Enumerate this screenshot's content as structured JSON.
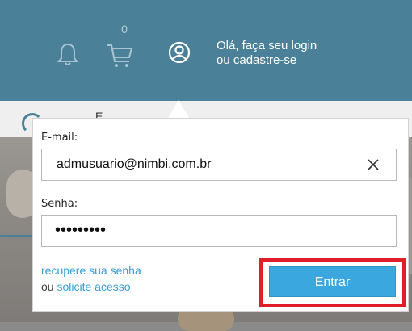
{
  "header": {
    "cart_count": "0",
    "greeting_line1": "Olá, faça seu login",
    "greeting_line2": "ou cadastre-se",
    "background_color": "#4b8198"
  },
  "background": {
    "partial_text": "E..."
  },
  "login": {
    "email_label": "E-mail:",
    "email_value": "admusuario@nimbi.com.br",
    "password_label": "Senha:",
    "password_value": "•••••••••",
    "recover_link": "recupere sua senha",
    "or_text": "ou",
    "request_link": "solicite acesso",
    "submit_label": "Entrar",
    "accent_color": "#3aa8de",
    "highlight_color": "#e01e2a"
  },
  "icons": {
    "bell": "bell-icon",
    "cart": "cart-icon",
    "user": "user-icon",
    "clear": "close-icon"
  }
}
